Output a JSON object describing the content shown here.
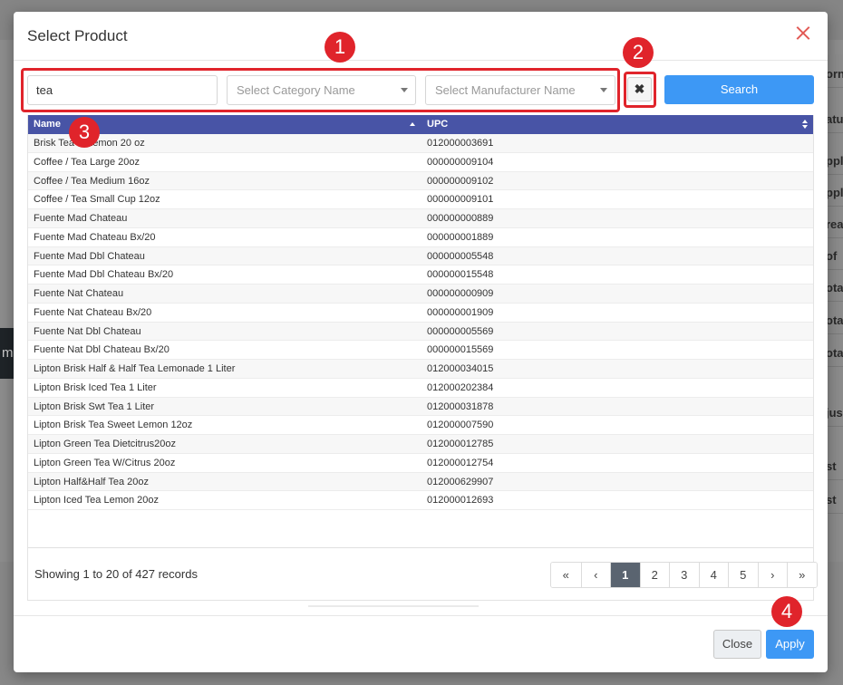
{
  "background": {
    "right_items": [
      "orn",
      "atu",
      "ppl",
      "ppl",
      "rea",
      "of",
      "ota",
      "ota",
      "ota",
      "jus",
      "st",
      "st"
    ],
    "left_peek": "m"
  },
  "modal": {
    "title": "Select Product",
    "search_value": "tea",
    "category_placeholder": "Select Category Name",
    "manufacturer_placeholder": "Select Manufacturer Name",
    "clear_glyph": "✖",
    "search_label": "Search",
    "close_label": "Close",
    "apply_label": "Apply"
  },
  "annotations": [
    "1",
    "2",
    "3",
    "4"
  ],
  "table": {
    "columns": [
      "Name",
      "UPC"
    ],
    "rows": [
      {
        "name": "Brisk Tea w Lemon 20 oz",
        "upc": "012000003691"
      },
      {
        "name": "Coffee / Tea Large 20oz",
        "upc": "000000009104"
      },
      {
        "name": "Coffee / Tea Medium 16oz",
        "upc": "000000009102"
      },
      {
        "name": "Coffee / Tea Small Cup 12oz",
        "upc": "000000009101"
      },
      {
        "name": "Fuente Mad Chateau",
        "upc": "000000000889"
      },
      {
        "name": "Fuente Mad Chateau Bx/20",
        "upc": "000000001889"
      },
      {
        "name": "Fuente Mad Dbl Chateau",
        "upc": "000000005548"
      },
      {
        "name": "Fuente Mad Dbl Chateau Bx/20",
        "upc": "000000015548"
      },
      {
        "name": "Fuente Nat Chateau",
        "upc": "000000000909"
      },
      {
        "name": "Fuente Nat Chateau Bx/20",
        "upc": "000000001909"
      },
      {
        "name": "Fuente Nat Dbl Chateau",
        "upc": "000000005569"
      },
      {
        "name": "Fuente Nat Dbl Chateau Bx/20",
        "upc": "000000015569"
      },
      {
        "name": "Lipton Brisk Half & Half Tea Lemonade 1 Liter",
        "upc": "012000034015"
      },
      {
        "name": "Lipton Brisk Iced Tea 1 Liter",
        "upc": "012000202384"
      },
      {
        "name": "Lipton Brisk Swt Tea 1 Liter",
        "upc": "012000031878"
      },
      {
        "name": "Lipton Brisk Tea Sweet Lemon 12oz",
        "upc": "012000007590"
      },
      {
        "name": "Lipton Green Tea Dietcitrus20oz",
        "upc": "012000012785"
      },
      {
        "name": "Lipton Green Tea W/Citrus 20oz",
        "upc": "012000012754"
      },
      {
        "name": "Lipton Half&Half Tea 20oz",
        "upc": "012000629907"
      },
      {
        "name": "Lipton Iced Tea Lemon 20oz",
        "upc": "012000012693"
      }
    ],
    "records_text": "Showing 1 to 20 of 427 records"
  },
  "pagination": {
    "first": "«",
    "prev": "‹",
    "pages": [
      "1",
      "2",
      "3",
      "4",
      "5"
    ],
    "next": "›",
    "last": "»",
    "active_page": "1"
  },
  "colors": {
    "header_bg": "#4854a6",
    "primary": "#3d98f5",
    "annotation": "#e0242b",
    "close_icon": "#e25a55"
  }
}
